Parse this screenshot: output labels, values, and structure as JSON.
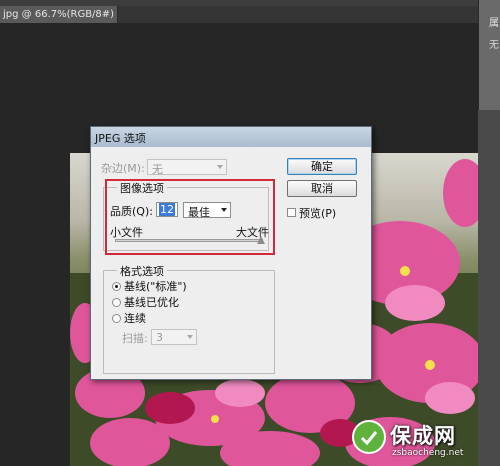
{
  "doc_tab": {
    "title": "jpg @ 66.7%(RGB/8#) *",
    "close": "×"
  },
  "right_panel": {
    "label1": "属",
    "label2": "无"
  },
  "dialog": {
    "title": "JPEG 选项",
    "matte_label": "杂边(M):",
    "matte_value": "无",
    "ok_label": "确定",
    "cancel_label": "取消",
    "preview_label": "预览(P)",
    "image_options": {
      "group_title": "图像选项",
      "quality_label": "品质(Q):",
      "quality_value": "12",
      "quality_preset": "最佳",
      "small_file_label": "小文件",
      "large_file_label": "大文件",
      "quality_fraction": 1.0
    },
    "format_options": {
      "group_title": "格式选项",
      "radios": [
        "基线(\"标准\")",
        "基线已优化",
        "连续"
      ],
      "selected_index": 0,
      "scans_label": "扫描:",
      "scans_value": "3"
    }
  },
  "watermark": {
    "title": "保成网",
    "url": "zsbaocheng.net"
  },
  "colors": {
    "highlight": "#d3293a",
    "titlebar": "#b7c7d9",
    "watermark_green": "#5fb33c"
  }
}
